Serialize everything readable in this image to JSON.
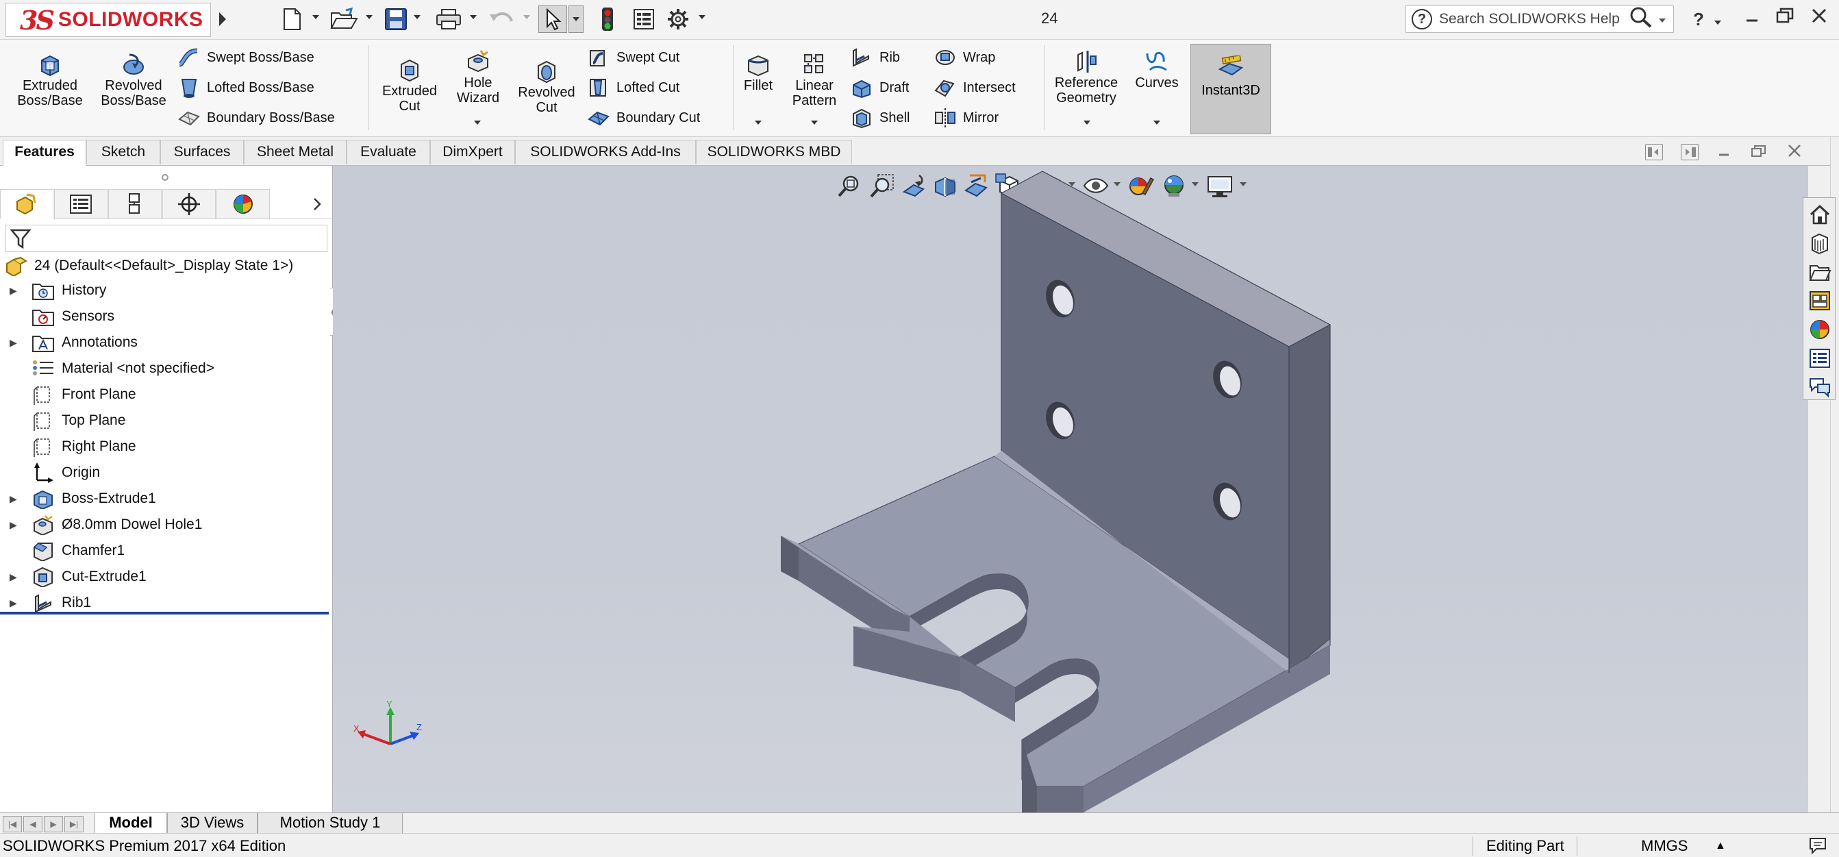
{
  "app": {
    "logo_mark": "3S",
    "logo_text": "SOLIDWORKS",
    "document_title": "24",
    "help_search_placeholder": "Search SOLIDWORKS Help",
    "brand_color": "#d3202b"
  },
  "commands": {
    "extruded_boss": [
      "Extruded",
      "Boss/Base"
    ],
    "revolved_boss": [
      "Revolved",
      "Boss/Base"
    ],
    "swept_boss": "Swept Boss/Base",
    "lofted_boss": "Lofted Boss/Base",
    "boundary_boss": "Boundary Boss/Base",
    "extruded_cut": [
      "Extruded",
      "Cut"
    ],
    "hole_wizard": [
      "Hole",
      "Wizard"
    ],
    "revolved_cut": [
      "Revolved",
      "Cut"
    ],
    "swept_cut": "Swept Cut",
    "lofted_cut": "Lofted Cut",
    "boundary_cut": "Boundary Cut",
    "fillet": "Fillet",
    "linear_pattern": [
      "Linear",
      "Pattern"
    ],
    "rib": "Rib",
    "draft": "Draft",
    "shell": "Shell",
    "wrap": "Wrap",
    "intersect": "Intersect",
    "mirror": "Mirror",
    "reference_geometry": [
      "Reference",
      "Geometry"
    ],
    "curves": "Curves",
    "instant3d": "Instant3D",
    "instant3d_active": true
  },
  "cm_tabs": [
    "Features",
    "Sketch",
    "Surfaces",
    "Sheet Metal",
    "Evaluate",
    "DimXpert",
    "SOLIDWORKS Add-Ins",
    "SOLIDWORKS MBD"
  ],
  "cm_active_tab": "Features",
  "feature_tree": {
    "root": "24  (Default<<Default>_Display State 1>)",
    "items": [
      {
        "label": "History",
        "icon": "history-folder-icon",
        "expandable": true
      },
      {
        "label": "Sensors",
        "icon": "sensors-icon",
        "expandable": false
      },
      {
        "label": "Annotations",
        "icon": "annotations-icon",
        "expandable": true
      },
      {
        "label": "Material <not specified>",
        "icon": "material-icon",
        "expandable": false
      },
      {
        "label": "Front Plane",
        "icon": "plane-icon",
        "expandable": false
      },
      {
        "label": "Top Plane",
        "icon": "plane-icon",
        "expandable": false
      },
      {
        "label": "Right Plane",
        "icon": "plane-icon",
        "expandable": false
      },
      {
        "label": "Origin",
        "icon": "origin-icon",
        "expandable": false
      },
      {
        "label": "Boss-Extrude1",
        "icon": "boss-extrude-icon",
        "expandable": true
      },
      {
        "label": "Ø8.0mm Dowel Hole1",
        "icon": "hole-wizard-icon",
        "expandable": true
      },
      {
        "label": "Chamfer1",
        "icon": "chamfer-icon",
        "expandable": false
      },
      {
        "label": "Cut-Extrude1",
        "icon": "cut-extrude-icon",
        "expandable": true
      },
      {
        "label": "Rib1",
        "icon": "rib-icon",
        "expandable": true
      }
    ]
  },
  "triad": {
    "x": "X",
    "y": "Y",
    "z": "Z"
  },
  "bottom_tabs": [
    "Model",
    "3D Views",
    "Motion Study 1"
  ],
  "bottom_active_tab": "Model",
  "status": {
    "edition": "SOLIDWORKS Premium 2017 x64 Edition",
    "mode": "Editing Part",
    "units": "MMGS",
    "units_arrow": "▲"
  }
}
